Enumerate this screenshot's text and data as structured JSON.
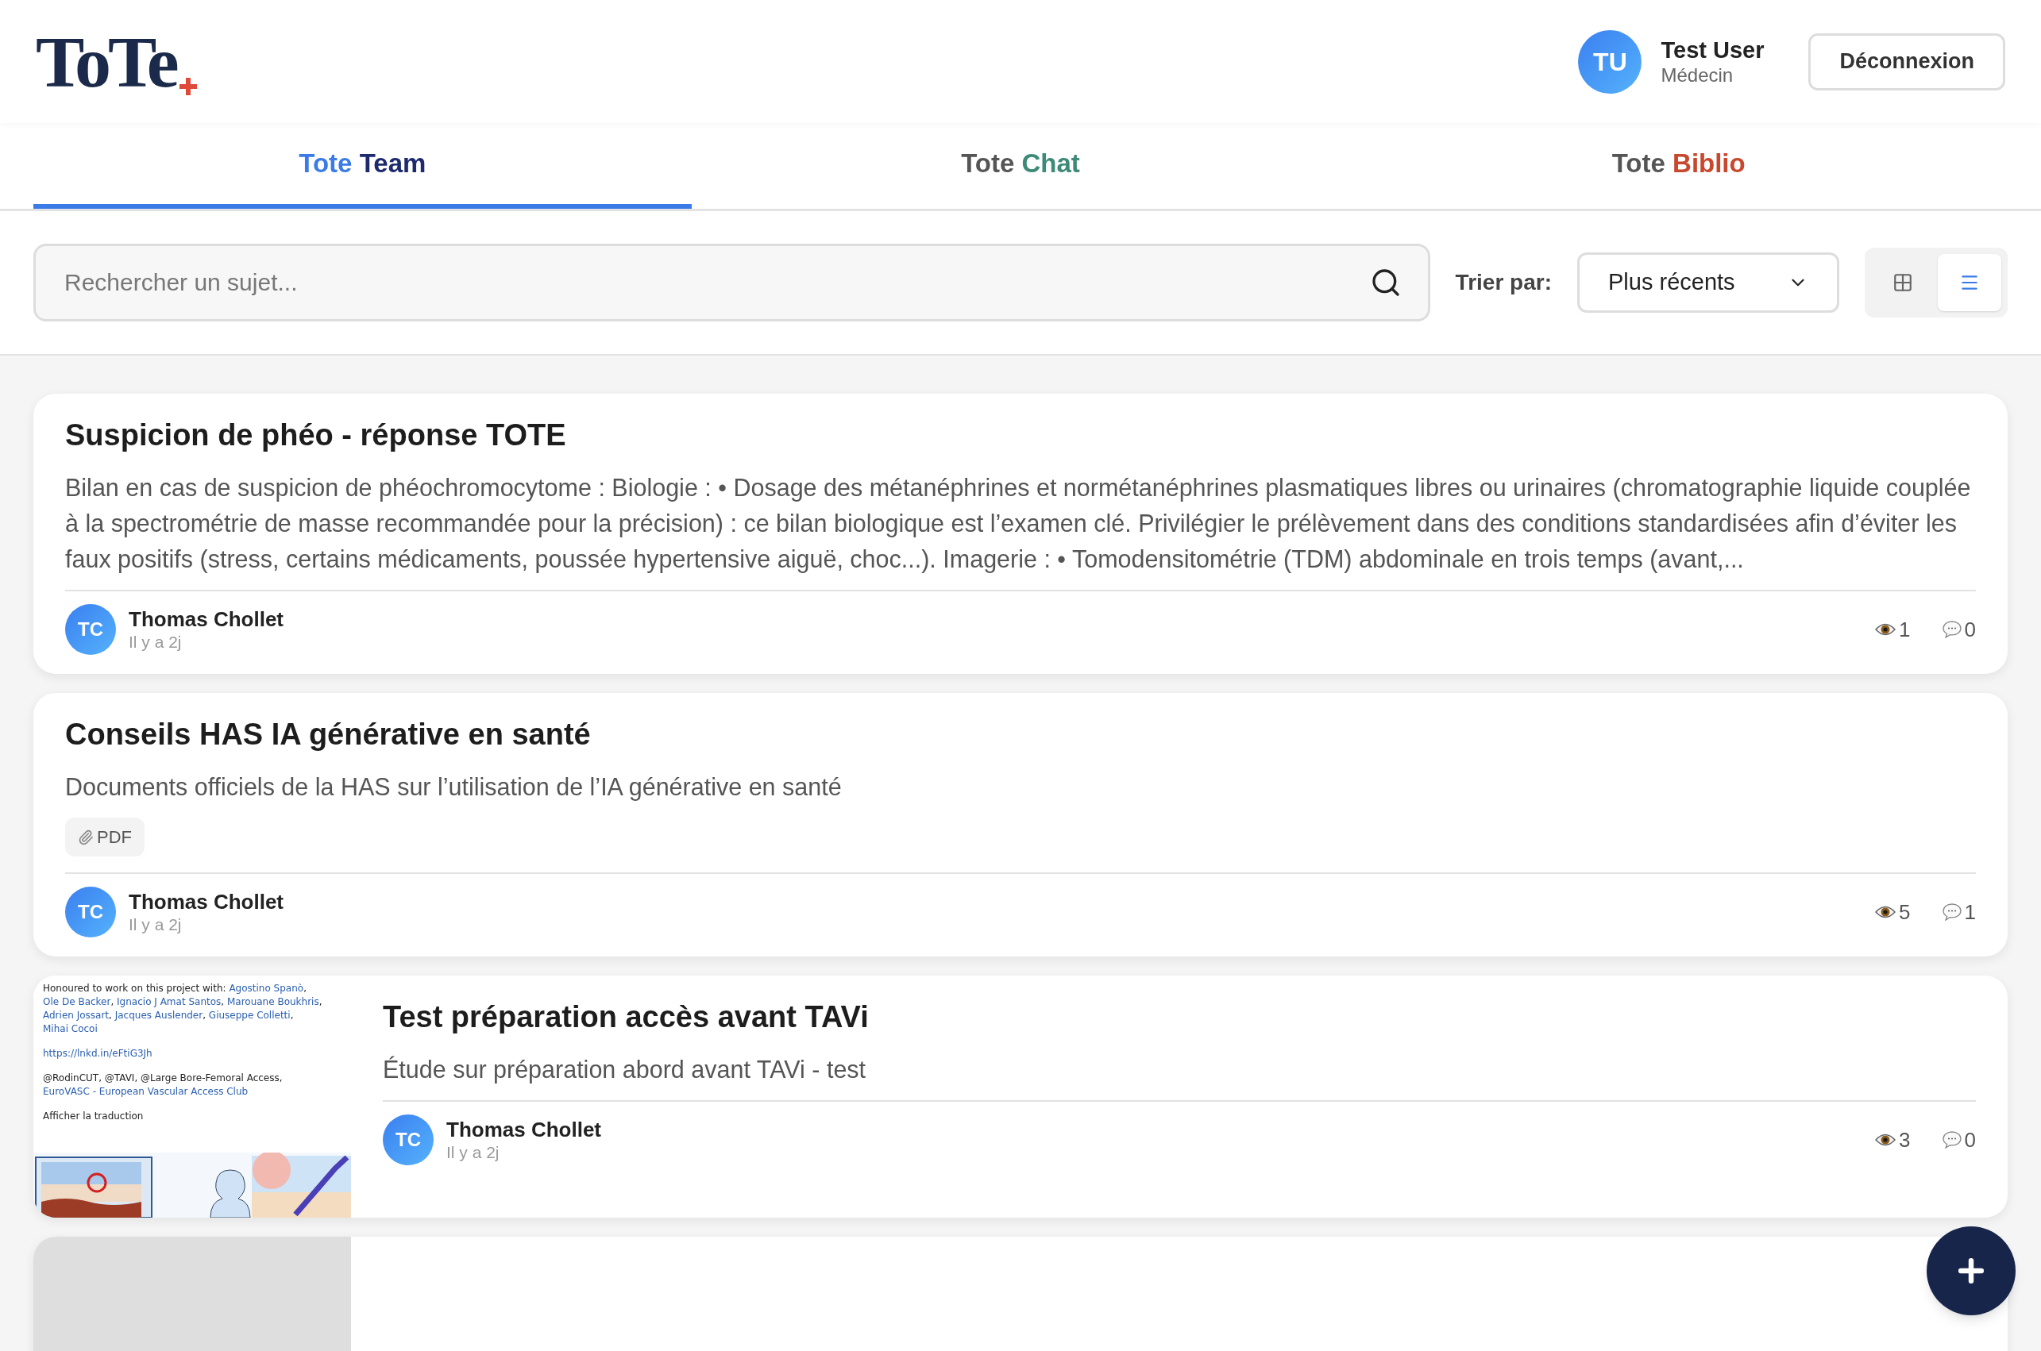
{
  "header": {
    "logo": "ToTe",
    "user": {
      "initials": "TU",
      "name": "Test User",
      "role": "Médecin"
    },
    "logout": "Déconnexion"
  },
  "tabs": [
    {
      "prefix": "Tote",
      "name": "Team",
      "color": "#1e2a6e",
      "selected": true
    },
    {
      "prefix": "Tote",
      "name": "Chat",
      "color": "#3d8a78",
      "selected": false
    },
    {
      "prefix": "Tote",
      "name": "Biblio",
      "color": "#c8472d",
      "selected": false
    }
  ],
  "toolbar": {
    "search": {
      "placeholder": "Rechercher un sujet..."
    },
    "sort_label": "Trier par:",
    "sort_value": "Plus récents",
    "views": [
      {
        "kind": "grid",
        "selected": false
      },
      {
        "kind": "list",
        "selected": true
      }
    ]
  },
  "posts": [
    {
      "title": "Suspicion de phéo - réponse TOTE",
      "body": "Bilan en cas de suspicion de phéochromocytome : Biologie : • Dosage des métanéphrines et normétanéphrines plasmatiques libres ou urinaires (chromatographie liquide couplée à la spectrométrie de masse recommandée pour la précision) : ce bilan biologique est l’examen clé. Privilégier le prélèvement dans des conditions standardisées afin d’éviter les faux positifs (stress, certains médicaments, poussée hypertensive aiguë, choc...). Imagerie : • Tomodensitométrie (TDM) abdominale en trois temps (avant,...",
      "author_initials": "TC",
      "author": "Thomas Chollet",
      "time": "Il y a 2j",
      "views": "1",
      "comments": "0"
    },
    {
      "title": "Conseils HAS IA générative en santé",
      "body": "Documents officiels de la HAS sur l’utilisation de l’IA générative en santé",
      "attachment": "PDF",
      "author_initials": "TC",
      "author": "Thomas Chollet",
      "time": "Il y a 2j",
      "views": "5",
      "comments": "1"
    },
    {
      "title": "Test préparation accès avant TAVi",
      "body": "Étude sur préparation abord avant TAVi - test",
      "thumbnail": {
        "kind": "screenshot",
        "paragraphs": [
          [
            {
              "text": "Honoured to work on this project with: ",
              "link": false
            },
            {
              "text": "Agostino Spanò",
              "link": true
            },
            {
              "text": ", ",
              "link": false
            },
            {
              "text": "Ole De Backer",
              "link": true
            },
            {
              "text": ", ",
              "link": false
            },
            {
              "text": "Ignacio J Amat Santos",
              "link": true
            },
            {
              "text": ", ",
              "link": false
            },
            {
              "text": "Marouane Boukhris",
              "link": true
            },
            {
              "text": ", ",
              "link": false
            },
            {
              "text": "Adrien Jossart",
              "link": true
            },
            {
              "text": ", ",
              "link": false
            },
            {
              "text": "Jacques Auslender",
              "link": true
            },
            {
              "text": ", ",
              "link": false
            },
            {
              "text": "Giuseppe Colletti",
              "link": true
            },
            {
              "text": ", ",
              "link": false
            },
            {
              "text": "Mihai Cocoi",
              "link": true
            }
          ],
          [
            {
              "text": "https://lnkd.in/eFtiG3Jh",
              "link": true
            }
          ],
          [
            {
              "text": "@RodinCUT, @TAVI, @Large Bore-Femoral Access, ",
              "link": false
            },
            {
              "text": "EuroVASC - European Vascular Access Club",
              "link": true
            }
          ],
          [
            {
              "text": "Afficher la traduction",
              "link": false
            }
          ]
        ]
      },
      "author_initials": "TC",
      "author": "Thomas Chollet",
      "time": "Il y a 2j",
      "views": "3",
      "comments": "0"
    },
    {
      "thumbnail": {
        "kind": "placeholder"
      }
    }
  ]
}
